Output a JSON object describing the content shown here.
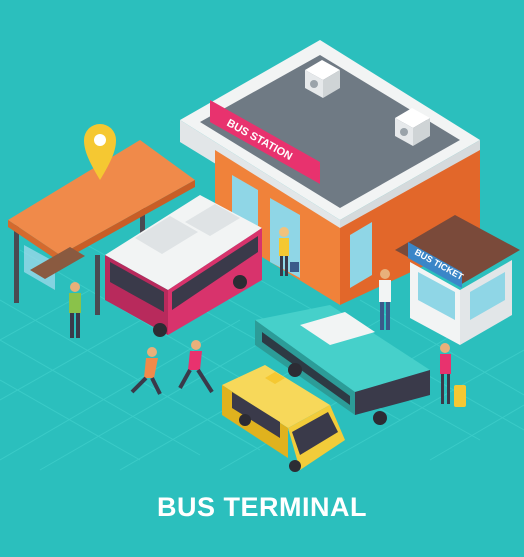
{
  "caption": "BUS TERMINAL",
  "signs": {
    "station": "BUS STATION",
    "ticket": "BUS TICKET"
  },
  "colors": {
    "background": "#2bbfbd",
    "floor_line": "#3fd0cc",
    "station_orange": "#f0823a",
    "station_white": "#f2f4f4",
    "sign_pink": "#e8326e",
    "canopy_orange": "#f08a4a",
    "pin_yellow": "#f5c832",
    "bus_pink": "#d8336c",
    "bus_teal": "#3fc6c0",
    "taxi_yellow": "#f2cc3a",
    "booth_brown": "#7a4a3a"
  },
  "icons": [
    "location-pin-icon"
  ]
}
